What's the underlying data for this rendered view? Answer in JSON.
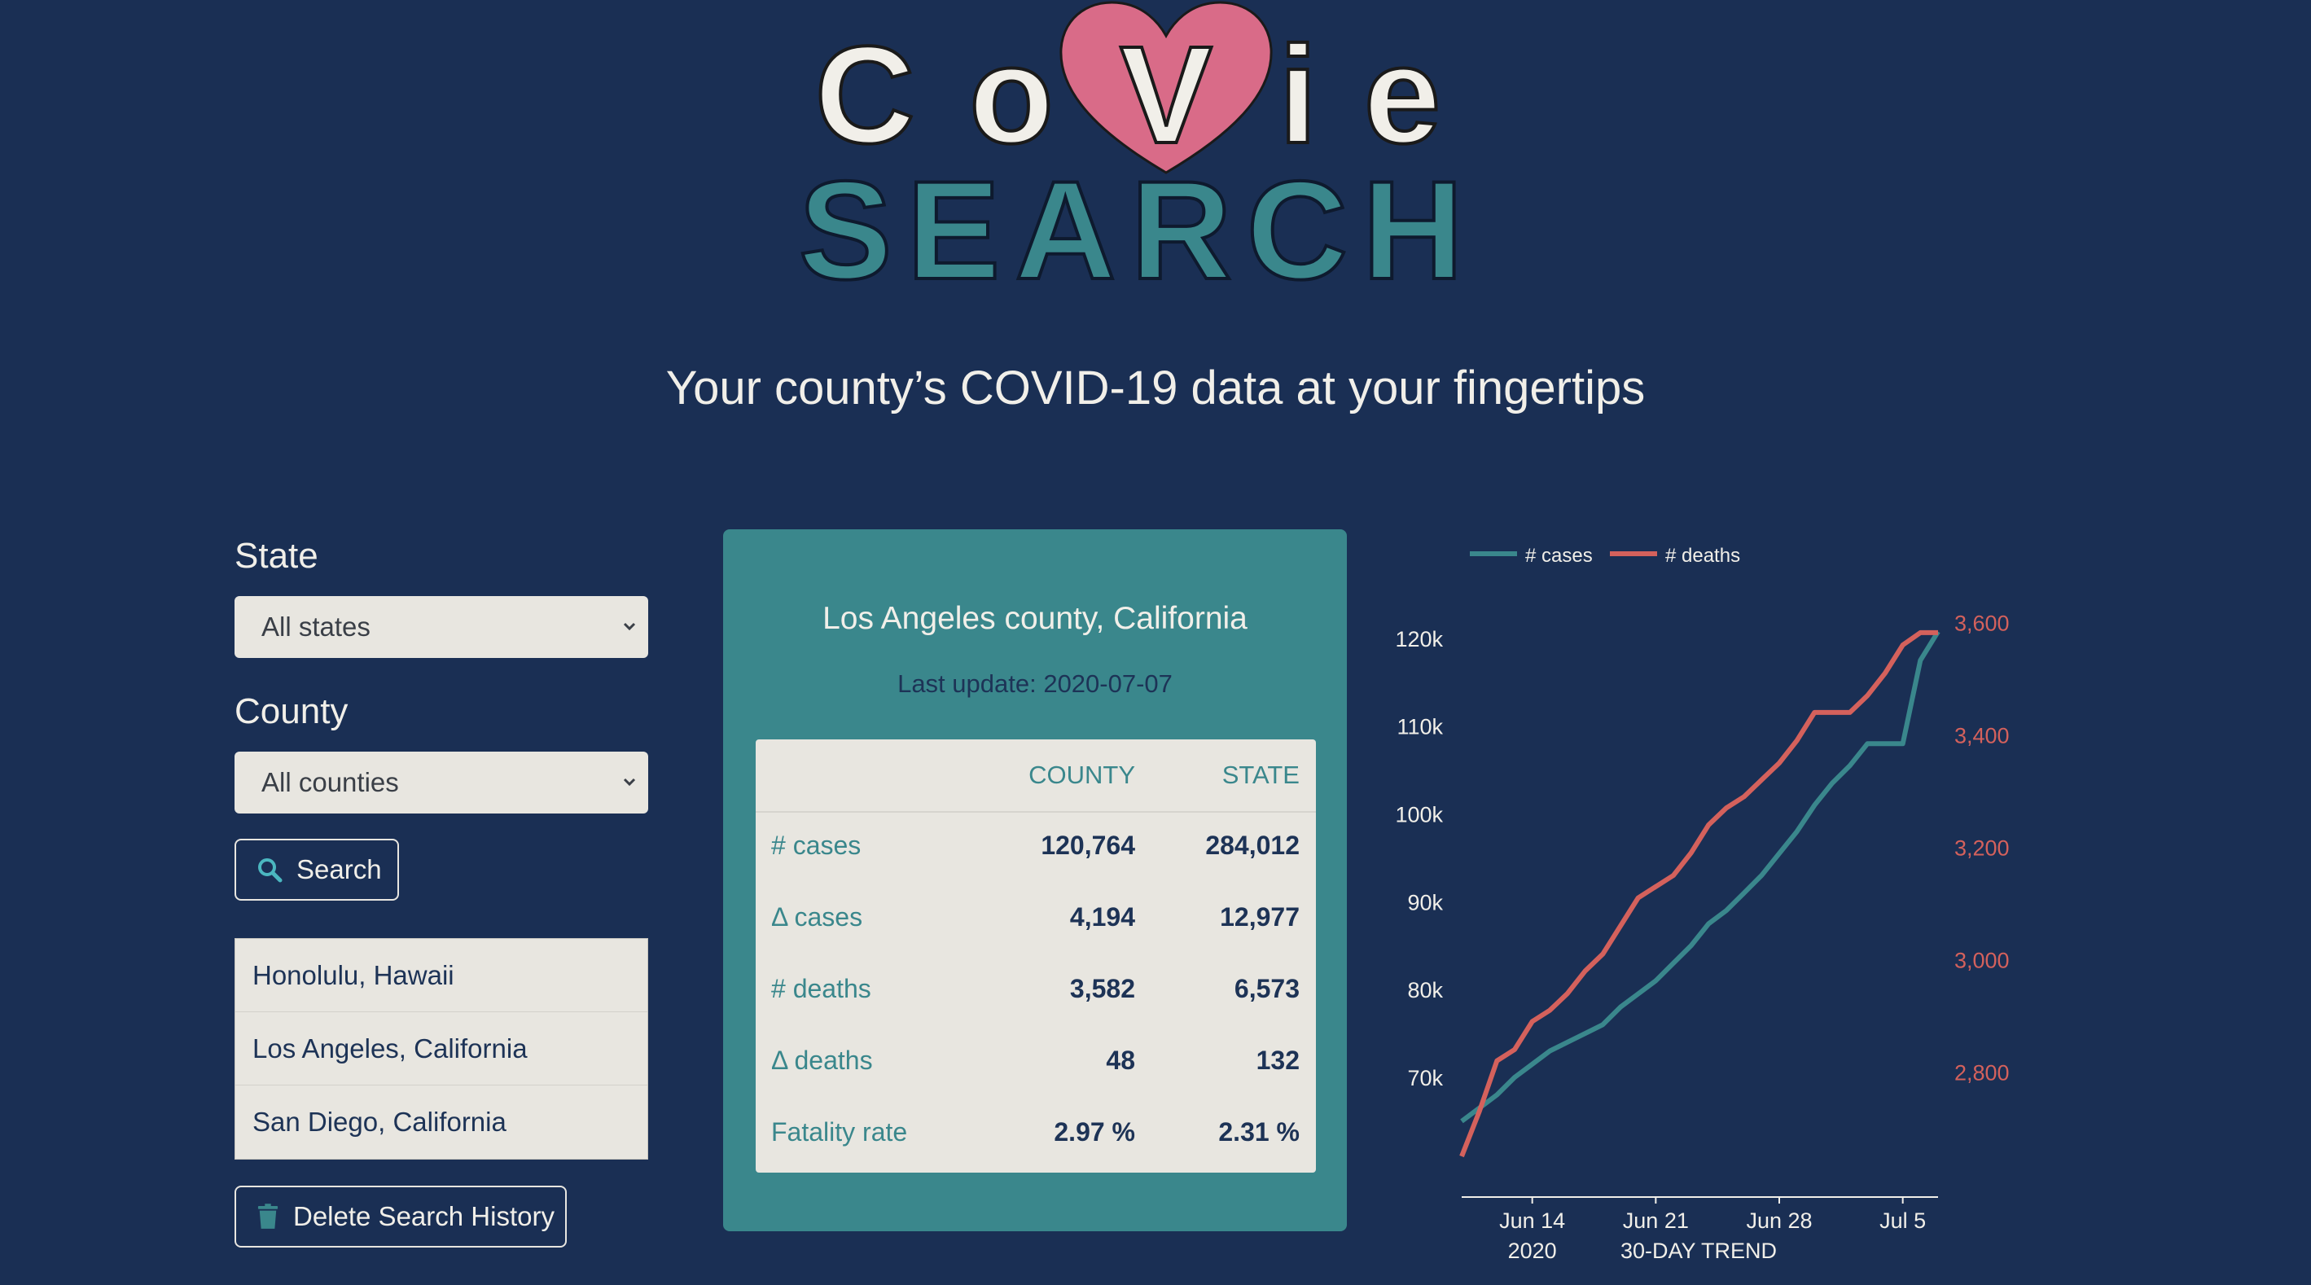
{
  "logo": {
    "covie_letters": [
      "C",
      "o",
      "V",
      "i",
      "e"
    ],
    "search_word": "SEARCH"
  },
  "subtitle": "Your county’s COVID-19 data at your fingertips",
  "filters": {
    "state_label": "State",
    "state_selected": "All states",
    "county_label": "County",
    "county_selected": "All counties",
    "search_button": "Search"
  },
  "history": {
    "items": [
      "Honolulu, Hawaii",
      "Los Angeles, California",
      "San Diego, California"
    ],
    "delete_button": "Delete Search History"
  },
  "card": {
    "title": "Los Angeles county, California",
    "last_update": "Last update: 2020-07-07",
    "col_county": "COUNTY",
    "col_state": "STATE",
    "rows": [
      {
        "label": "# cases",
        "county": "120,764",
        "state": "284,012"
      },
      {
        "label": "Δ cases",
        "county": "4,194",
        "state": "12,977"
      },
      {
        "label": "# deaths",
        "county": "3,582",
        "state": "6,573"
      },
      {
        "label": "Δ deaths",
        "county": "48",
        "state": "132"
      },
      {
        "label": "Fatality rate",
        "county": "2.97 %",
        "state": "2.31 %"
      }
    ]
  },
  "colors": {
    "background": "#1a2f54",
    "teal": "#3a878c",
    "coral": "#d4615c",
    "pink_heart": "#d96b88",
    "panel_light": "#e8e6e0"
  },
  "chart_data": {
    "type": "line",
    "xlabel": "30-DAY TREND",
    "x_tick_labels": [
      "Jun 14",
      "Jun 21",
      "Jun 28",
      "Jul 5"
    ],
    "x_year_label": "2020",
    "y_left_ticks": [
      "70k",
      "80k",
      "90k",
      "100k",
      "110k",
      "120k"
    ],
    "y_right_ticks": [
      "2,800",
      "3,000",
      "3,200",
      "3,400",
      "3,600"
    ],
    "y_left_range": [
      61000,
      125000
    ],
    "y_right_range": [
      2650,
      3650
    ],
    "x": [
      "2020-06-10",
      "2020-06-11",
      "2020-06-12",
      "2020-06-13",
      "2020-06-14",
      "2020-06-15",
      "2020-06-16",
      "2020-06-17",
      "2020-06-18",
      "2020-06-19",
      "2020-06-20",
      "2020-06-21",
      "2020-06-22",
      "2020-06-23",
      "2020-06-24",
      "2020-06-25",
      "2020-06-26",
      "2020-06-27",
      "2020-06-28",
      "2020-06-29",
      "2020-06-30",
      "2020-07-01",
      "2020-07-02",
      "2020-07-03",
      "2020-07-04",
      "2020-07-05",
      "2020-07-06",
      "2020-07-07"
    ],
    "legend": "top-left",
    "series": [
      {
        "name": "# cases",
        "axis": "left",
        "color": "#3a878c",
        "values": [
          65000,
          66500,
          68000,
          70000,
          71500,
          73000,
          74000,
          75000,
          76000,
          78000,
          79500,
          81000,
          83000,
          85000,
          87500,
          89000,
          91000,
          93000,
          95500,
          98000,
          101000,
          103500,
          105500,
          108000,
          108000,
          108000,
          117500,
          120764
        ]
      },
      {
        "name": "# deaths",
        "axis": "right",
        "color": "#d4615c",
        "values": [
          2650,
          2730,
          2820,
          2840,
          2890,
          2910,
          2940,
          2980,
          3010,
          3060,
          3110,
          3130,
          3150,
          3190,
          3240,
          3270,
          3290,
          3320,
          3350,
          3390,
          3440,
          3440,
          3440,
          3470,
          3510,
          3560,
          3582,
          3582
        ]
      }
    ]
  }
}
